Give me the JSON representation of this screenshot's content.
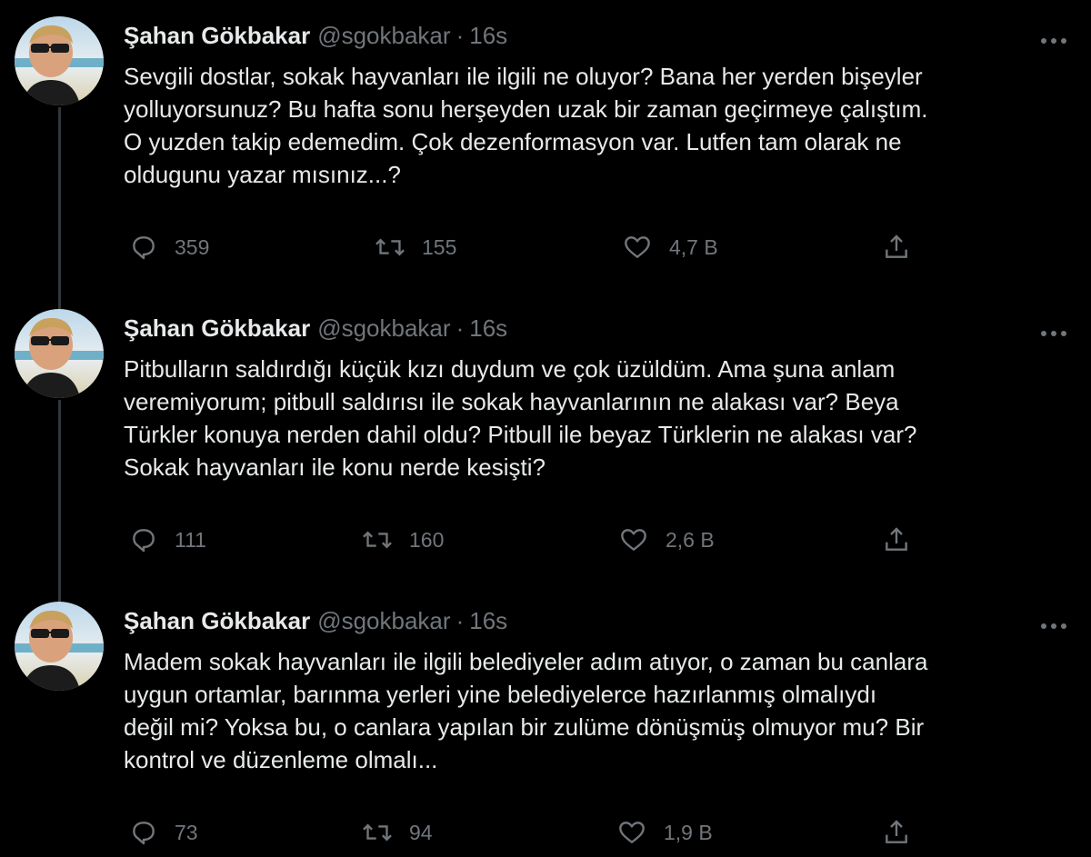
{
  "tweets": [
    {
      "name": "Şahan Gökbakar",
      "handle": "@sgokbakar",
      "separator": "·",
      "time": "16s",
      "lines": [
        "Sevgili dostlar, sokak hayvanları ile ilgili ne oluyor? Bana her yerden bişeyler",
        "yolluyorsunuz? Bu hafta sonu herşeyden uzak bir zaman geçirmeye çalıştım.",
        "O yuzden takip edemedim. Çok dezenformasyon var. Lutfen tam olarak ne",
        "oldugunu yazar mısınız...?"
      ],
      "replies": "359",
      "retweets": "155",
      "likes": "4,7 B"
    },
    {
      "name": "Şahan Gökbakar",
      "handle": "@sgokbakar",
      "separator": "·",
      "time": "16s",
      "lines": [
        "Pitbulların saldırdığı küçük kızı duydum ve çok üzüldüm. Ama şuna anlam",
        "veremiyorum; pitbull saldırısı ile sokak hayvanlarının ne alakası var? Beya",
        "Türkler konuya nerden dahil oldu? Pitbull ile beyaz Türklerin ne alakası var?",
        "Sokak hayvanları ile konu nerde kesişti?"
      ],
      "replies": "111",
      "retweets": "160",
      "likes": "2,6 B"
    },
    {
      "name": "Şahan Gökbakar",
      "handle": "@sgokbakar",
      "separator": "·",
      "time": "16s",
      "lines": [
        "Madem sokak hayvanları ile ilgili belediyeler adım atıyor, o zaman bu canlara",
        "uygun ortamlar, barınma yerleri yine belediyelerce hazırlanmış olmalıydı",
        "değil mi? Yoksa bu, o canlara yapılan bir zulüme dönüşmüş olmuyor mu? Bir",
        "kontrol ve düzenleme olmalı..."
      ],
      "replies": "73",
      "retweets": "94",
      "likes": "1,9 B"
    }
  ],
  "icons": {
    "reply": "reply-icon",
    "retweet": "retweet-icon",
    "like": "like-icon",
    "share": "share-icon",
    "more": "more-icon"
  },
  "colors": {
    "background": "#000000",
    "text": "#e7e9ea",
    "secondary": "#71767b",
    "thread_line": "#333639"
  }
}
